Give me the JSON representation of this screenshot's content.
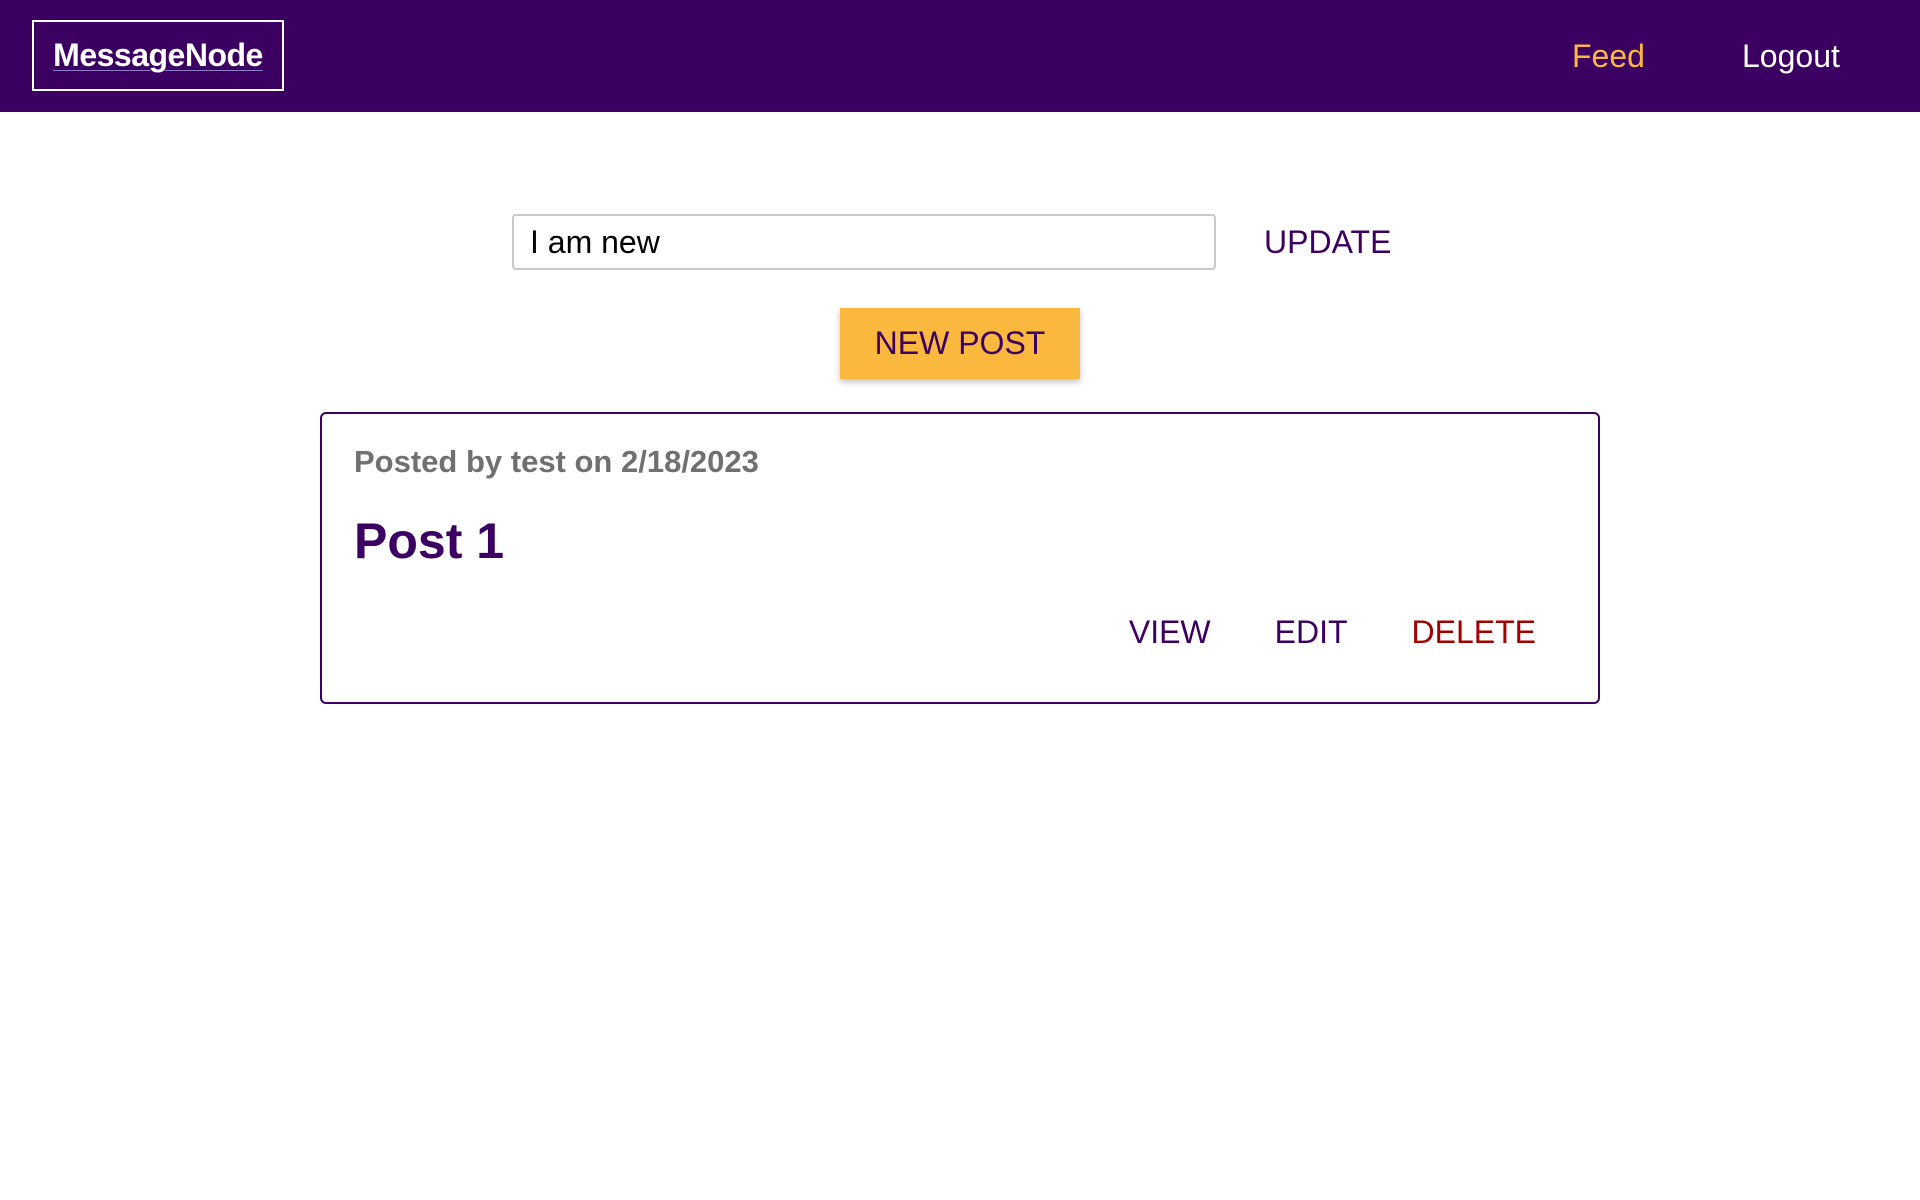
{
  "header": {
    "logo": "MessageNode",
    "nav": {
      "feed": "Feed",
      "logout": "Logout"
    }
  },
  "status": {
    "input_value": "I am new",
    "update_label": "UPDATE"
  },
  "new_post_label": "NEW POST",
  "posts": [
    {
      "meta": "Posted by test on 2/18/2023",
      "title": "Post 1",
      "actions": {
        "view": "VIEW",
        "edit": "EDIT",
        "delete": "DELETE"
      }
    }
  ],
  "colors": {
    "primary": "#3b0062",
    "accent": "#fab83f",
    "danger": "#a30000",
    "meta_text": "#707070"
  }
}
